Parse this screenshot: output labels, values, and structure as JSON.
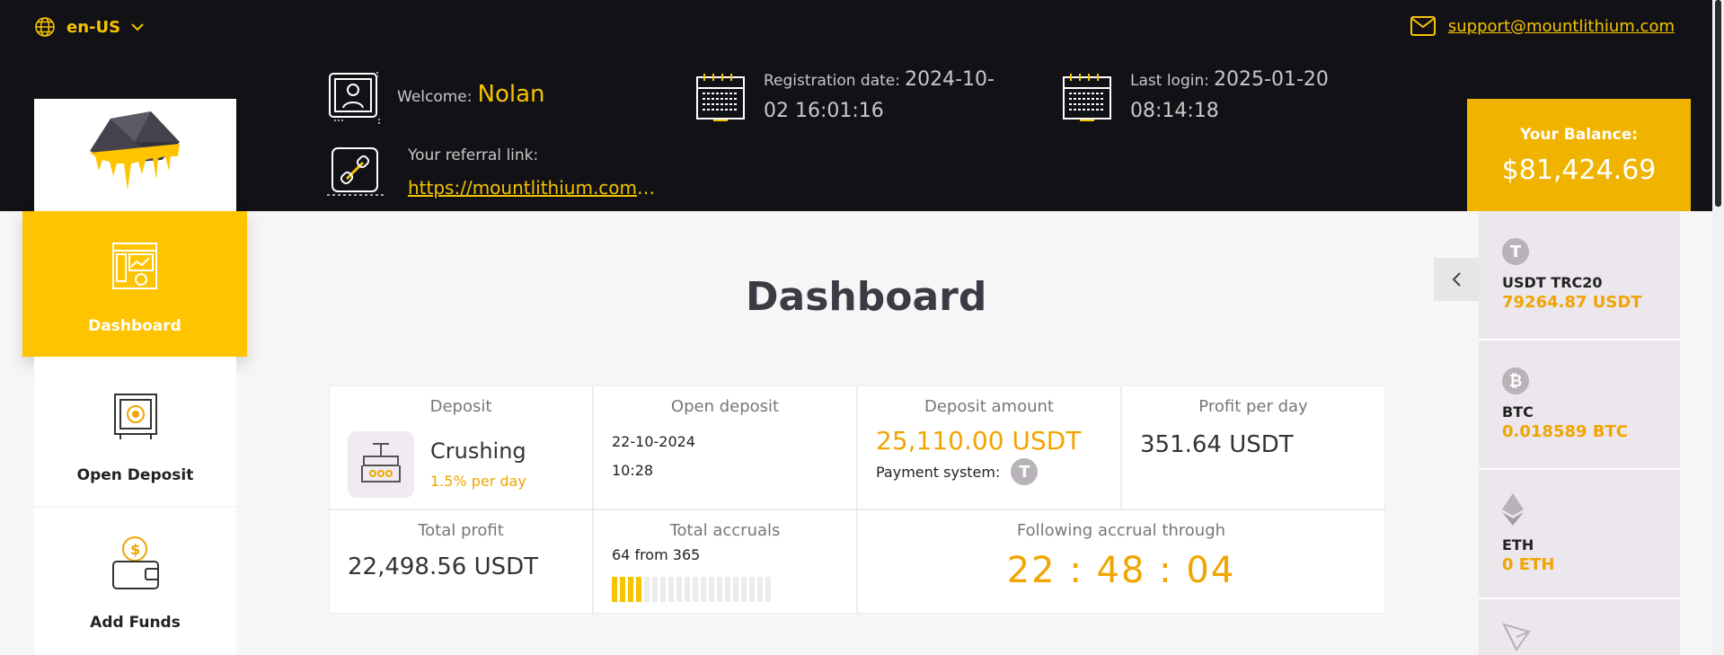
{
  "header": {
    "language": "en-US",
    "support_email": "support@mountlithium.com",
    "welcome_label": "Welcome:",
    "username": "Nolan",
    "registration_label": "Registration date:",
    "registration_value": "2024-10-02 16:01:16",
    "last_login_label": "Last login:",
    "last_login_value": "2025-01-20 08:14:18",
    "referral_label": "Your referral link:",
    "referral_link": "https://mountlithium.com/?u…"
  },
  "balance": {
    "label": "Your Balance:",
    "value": "$81,424.69"
  },
  "sidebar": {
    "items": [
      {
        "label": "Dashboard",
        "active": true
      },
      {
        "label": "Open Deposit",
        "active": false
      },
      {
        "label": "Add Funds",
        "active": false
      }
    ]
  },
  "main": {
    "title": "Dashboard",
    "deposit": {
      "header": "Deposit",
      "plan_name": "Crushing",
      "plan_rate": "1.5% per day"
    },
    "open_deposit": {
      "header": "Open deposit",
      "date": "22-10-2024",
      "time": "10:28"
    },
    "deposit_amount": {
      "header": "Deposit amount",
      "value": "25,110.00 USDT",
      "payment_label": "Payment system:"
    },
    "profit_per_day": {
      "header": "Profit per day",
      "value": "351.64 USDT"
    },
    "total_profit": {
      "header": "Total profit",
      "value": "22,498.56 USDT"
    },
    "total_accruals": {
      "header": "Total accruals",
      "text": "64 from 365",
      "done": 64,
      "total": 365
    },
    "following_accrual": {
      "header": "Following accrual through",
      "hours": "22",
      "minutes": "48",
      "seconds": "04"
    }
  },
  "wallets": [
    {
      "name": "USDT TRC20",
      "balance": "79264.87 USDT",
      "icon": "tether-icon",
      "glyph": "T"
    },
    {
      "name": "BTC",
      "balance": "0.018589 BTC",
      "icon": "bitcoin-icon",
      "glyph": "₿"
    },
    {
      "name": "ETH",
      "balance": "0 ETH",
      "icon": "ethereum-icon",
      "glyph": ""
    },
    {
      "name": "",
      "balance": "",
      "icon": "tron-icon",
      "glyph": ""
    }
  ],
  "colors": {
    "accent": "#f5c400",
    "header_bg": "#121116",
    "balance_bg": "#f0b400",
    "wallet_bg": "#ece6ed"
  }
}
